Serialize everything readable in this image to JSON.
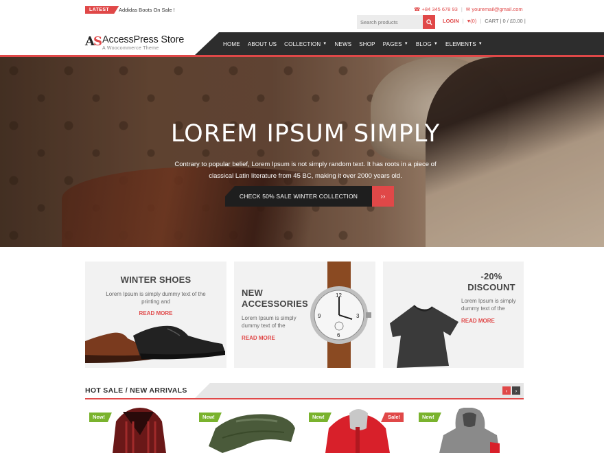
{
  "topbar": {
    "latest_label": "LATEST",
    "ticker_text": "Addidas Boots On Sale !",
    "phone": "+84 345 678 93",
    "email": "youremail@gmail.com",
    "search_placeholder": "Search products",
    "login_label": "LOGIN",
    "wishlist_count": "(0)",
    "cart_label": "CART | 0 / £0.00 |"
  },
  "header": {
    "logo_mark": "AS",
    "logo_title": "AccessPress Store",
    "logo_tagline": "A Woocommerce Theme"
  },
  "nav": {
    "items": [
      {
        "label": "HOME",
        "has_caret": false
      },
      {
        "label": "ABOUT US",
        "has_caret": false
      },
      {
        "label": "COLLECTION",
        "has_caret": true
      },
      {
        "label": "NEWS",
        "has_caret": false
      },
      {
        "label": "SHOP",
        "has_caret": false
      },
      {
        "label": "PAGES",
        "has_caret": true
      },
      {
        "label": "BLOG",
        "has_caret": true
      },
      {
        "label": "ELEMENTS",
        "has_caret": true
      }
    ]
  },
  "hero": {
    "title": "LOREM IPSUM SIMPLY",
    "text": "Contrary to popular belief, Lorem Ipsum is not simply random text. It has roots in a piece of classical Latin literature from 45 BC, making it over 2000 years old.",
    "cta_label": "CHECK 50% SALE WINTER COLLECTION",
    "cta_icon": "››"
  },
  "promos": [
    {
      "title": "WINTER SHOES",
      "text": "Lorem Ipsum is simply dummy text of the printing and",
      "more": "READ MORE"
    },
    {
      "title": "NEW ACCESSORIES",
      "text": "Lorem Ipsum is simply dummy text of the",
      "more": "READ MORE"
    },
    {
      "title": "-20% DISCOUNT",
      "text": "Lorem Ipsum is simply dummy text of the",
      "more": "READ MORE"
    }
  ],
  "section": {
    "title": "HOT SALE / NEW ARRIVALS",
    "prev_icon": "‹",
    "next_icon": "›"
  },
  "products": [
    {
      "badge": "New!"
    },
    {
      "badge": "New!"
    },
    {
      "badge": "New!",
      "badge_right": "Sale!"
    },
    {
      "badge": "New!"
    }
  ],
  "colors": {
    "accent": "#e04848",
    "nav_bg": "#2d2d2d",
    "new_badge": "#7ab32e"
  }
}
